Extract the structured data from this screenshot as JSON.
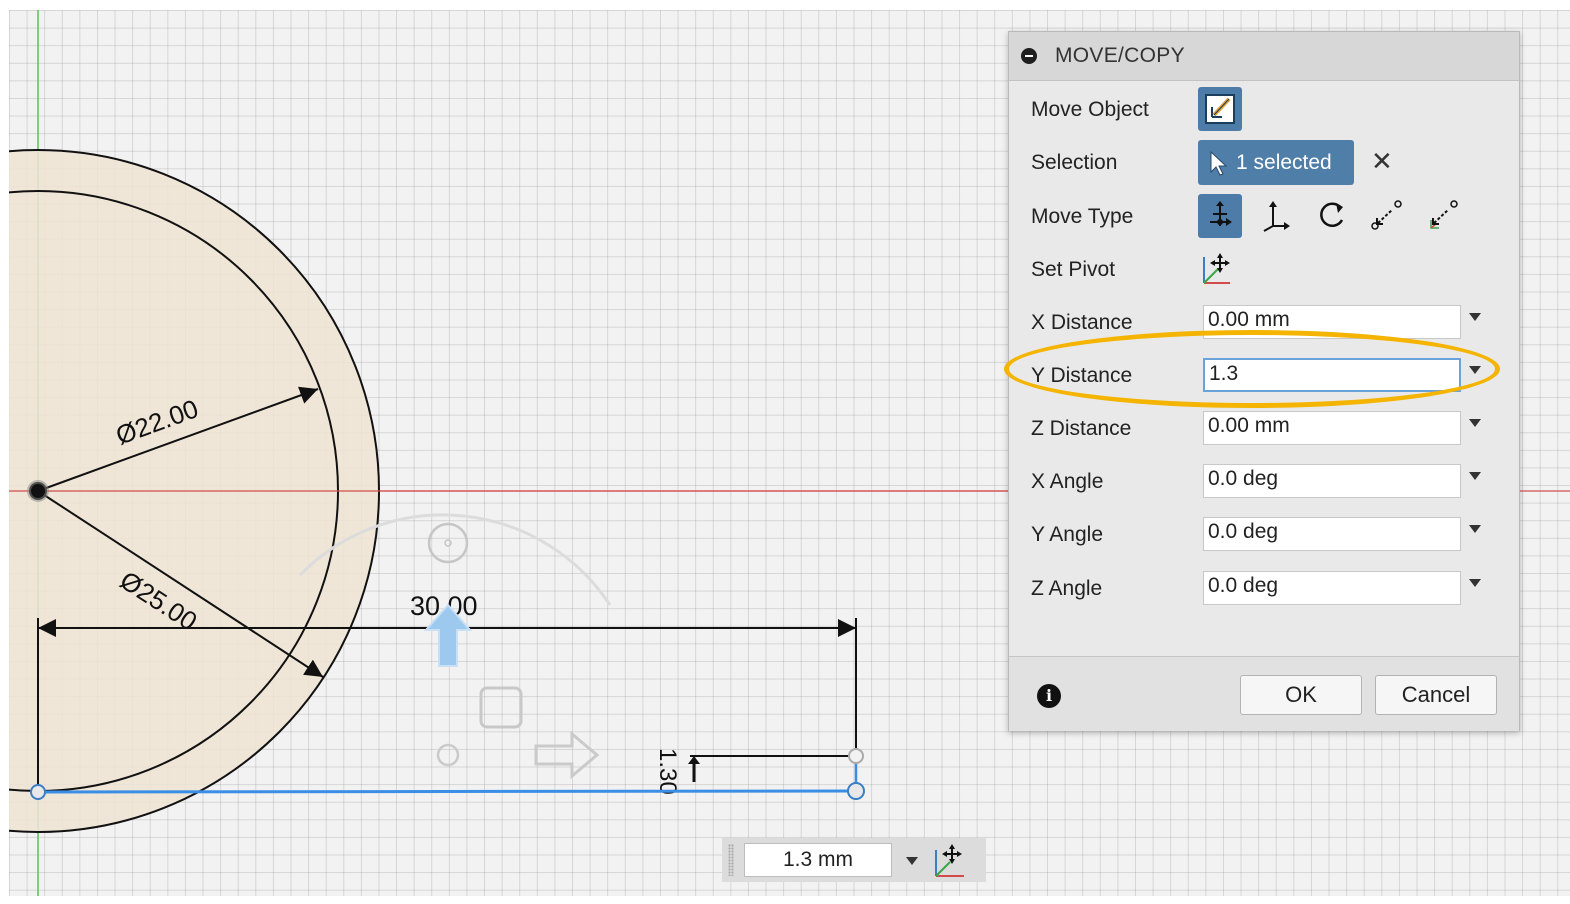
{
  "sketch": {
    "dim_outer_diameter": "Ø25.00",
    "dim_inner_diameter": "Ø22.00",
    "dim_length": "30.00",
    "dim_offset": "1.30"
  },
  "dialog": {
    "title": "MOVE/COPY",
    "move_object_label": "Move Object",
    "selection_label": "Selection",
    "selection_value": "1 selected",
    "move_type_label": "Move Type",
    "set_pivot_label": "Set Pivot",
    "fields": [
      {
        "label": "X Distance",
        "value": "0.00 mm"
      },
      {
        "label": "Y Distance",
        "value": "1.3"
      },
      {
        "label": "Z Distance",
        "value": "0.00 mm"
      },
      {
        "label": "X Angle",
        "value": "0.0 deg"
      },
      {
        "label": "Y Angle",
        "value": "0.0 deg"
      },
      {
        "label": "Z Angle",
        "value": "0.0 deg"
      }
    ],
    "ok_label": "OK",
    "cancel_label": "Cancel"
  },
  "floating_input": {
    "value": "1.3 mm"
  },
  "colors": {
    "accent_blue": "#4f7ea9",
    "highlight": "#f4b400",
    "x_axis": "#d25050",
    "y_axis": "#5cbf5c",
    "selected_line": "#3a8ee6",
    "profile_fill": "#efe4d4"
  }
}
